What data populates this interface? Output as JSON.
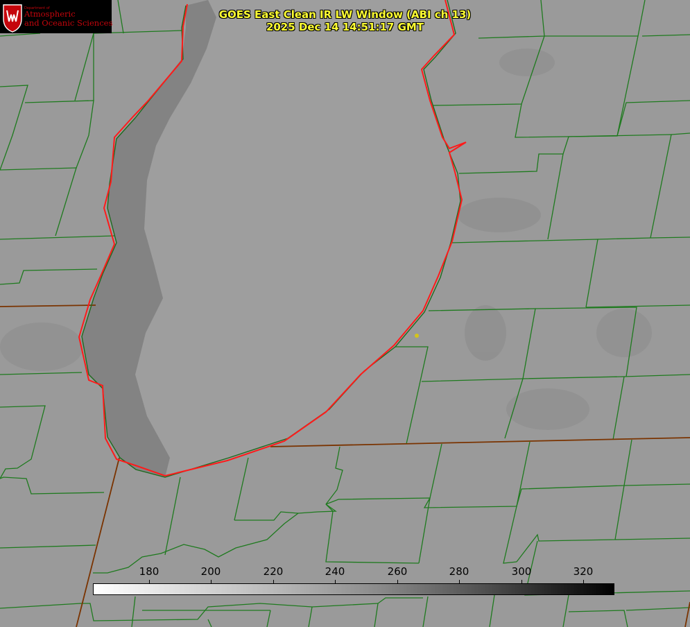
{
  "logo": {
    "department": "Department of",
    "line1": "Atmospheric",
    "line2": "and Oceanic Sciences"
  },
  "title": {
    "line1": "GOES East Clean IR LW Window (ABI ch 13)",
    "line2": "2025 Dec 14 14:51:17 GMT"
  },
  "colorbar": {
    "ticks": [
      "180",
      "200",
      "220",
      "240",
      "260",
      "280",
      "300",
      "320"
    ],
    "colors": [
      "#ffffff",
      "#000000"
    ]
  },
  "colors": {
    "shoreline": "#ff1a1a",
    "county_borders": "#1e7a1e",
    "state_borders": "#7a3300",
    "lake": "#9c9c9c",
    "land": "#9a9a9a",
    "marker": "#d4c41a",
    "title": "#ffff33"
  }
}
